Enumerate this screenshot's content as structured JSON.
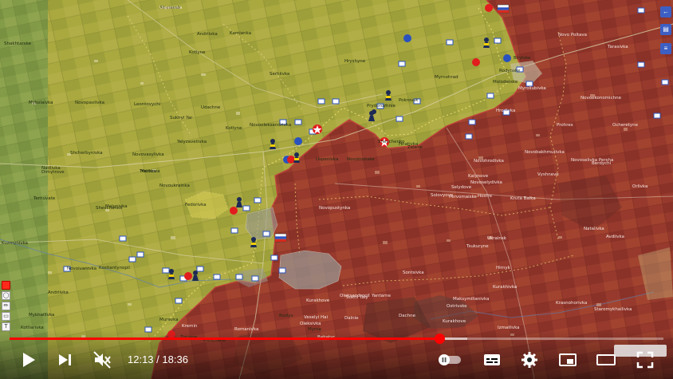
{
  "map": {
    "towns": [
      {
        "name": "Sloviansk",
        "tone": "lt"
      },
      {
        "name": "Andriivka",
        "tone": "lt"
      },
      {
        "name": "Kamianka",
        "tone": "lt"
      },
      {
        "name": "Shakhtarske",
        "tone": "lt"
      },
      {
        "name": "Kotlyne",
        "tone": "lt"
      },
      {
        "name": "Serhiivka",
        "tone": "lt"
      },
      {
        "name": "Hryshyne",
        "tone": "lt"
      },
      {
        "name": "Myrnohrad",
        "tone": "lt"
      },
      {
        "name": "Pokrovsk",
        "tone": "lt"
      },
      {
        "name": "Prydorozhnie",
        "tone": "lt"
      },
      {
        "name": "Bilytske",
        "tone": "lt"
      },
      {
        "name": "Rodynske",
        "tone": "lt"
      },
      {
        "name": "Molodetske",
        "tone": "lt"
      },
      {
        "name": "Mykolaivka",
        "tone": "lt"
      },
      {
        "name": "Novopavlivka",
        "tone": "lt"
      },
      {
        "name": "Novooleksandrivka",
        "tone": "lt"
      },
      {
        "name": "Udachne",
        "tone": "lt"
      },
      {
        "name": "Sukhyi Yar",
        "tone": "lt"
      },
      {
        "name": "Kotlyne",
        "tone": "lt"
      },
      {
        "name": "Shevchenko",
        "tone": "lt"
      },
      {
        "name": "Zelene",
        "tone": "lt"
      },
      {
        "name": "Uspenivka",
        "tone": "lt"
      },
      {
        "name": "Novotroitske",
        "tone": "lt"
      },
      {
        "name": "Hnativka",
        "tone": "lt"
      },
      {
        "name": "Hrodivka",
        "tone": "dk"
      },
      {
        "name": "Myroliubivka",
        "tone": "dk"
      },
      {
        "name": "Novoekonomichne",
        "tone": "dk"
      },
      {
        "name": "Novo Poltava",
        "tone": "dk"
      },
      {
        "name": "Tarasivka",
        "tone": "dk"
      },
      {
        "name": "Ocheretyne",
        "tone": "dk"
      },
      {
        "name": "Prohres",
        "tone": "dk"
      },
      {
        "name": "Novobakhmutivka",
        "tone": "dk"
      },
      {
        "name": "Berdychi",
        "tone": "dk"
      },
      {
        "name": "Novoselivka Persha",
        "tone": "dk"
      },
      {
        "name": "Orlivka",
        "tone": "dk"
      },
      {
        "name": "Novohrodivka",
        "tone": "dk"
      },
      {
        "name": "Kalynove",
        "tone": "dk"
      },
      {
        "name": "Solovyove",
        "tone": "dk"
      },
      {
        "name": "Pervomaiske",
        "tone": "dk"
      },
      {
        "name": "Hostre",
        "tone": "dk"
      },
      {
        "name": "Vyshneve",
        "tone": "dk"
      },
      {
        "name": "Selydove",
        "tone": "dk"
      },
      {
        "name": "Novoselydivka",
        "tone": "dk"
      },
      {
        "name": "Novopustynka",
        "tone": "dk"
      },
      {
        "name": "Kruta Balka",
        "tone": "dk"
      },
      {
        "name": "Sontsivka",
        "tone": "dk"
      },
      {
        "name": "Tsukuryne",
        "tone": "dk"
      },
      {
        "name": "Ukrainsk",
        "tone": "dk"
      },
      {
        "name": "Hirnyk",
        "tone": "dk"
      },
      {
        "name": "Natalivka",
        "tone": "dk"
      },
      {
        "name": "Avdiivka",
        "tone": "dk"
      },
      {
        "name": "Kurakhivka",
        "tone": "dk"
      },
      {
        "name": "Ostrivske",
        "tone": "dk"
      },
      {
        "name": "Izmailivka",
        "tone": "dk"
      },
      {
        "name": "Dachne",
        "tone": "dk"
      },
      {
        "name": "Kurakhove",
        "tone": "dk"
      },
      {
        "name": "Krasnohorivka",
        "tone": "dk"
      },
      {
        "name": "Staromykhailivka",
        "tone": "dk"
      },
      {
        "name": "Maksymilianivka",
        "tone": "dk"
      },
      {
        "name": "Oleksandropil",
        "tone": "dk"
      },
      {
        "name": "Oleksivka",
        "tone": "dk"
      },
      {
        "name": "Romanivka",
        "tone": "dk"
      },
      {
        "name": "Dalnie",
        "tone": "dk"
      },
      {
        "name": "Yantarne",
        "tone": "dk"
      },
      {
        "name": "Kremin",
        "tone": "dk"
      },
      {
        "name": "Veselyi Hai",
        "tone": "dk"
      },
      {
        "name": "Kurakhove",
        "tone": "dk"
      },
      {
        "name": "Troitske",
        "tone": "lt"
      },
      {
        "name": "Leontovychi",
        "tone": "lt"
      },
      {
        "name": "Yelyzavetivka",
        "tone": "lt"
      },
      {
        "name": "Novovasylivka",
        "tone": "lt"
      },
      {
        "name": "Shcherbynivka",
        "tone": "lt"
      },
      {
        "name": "Nadiivka",
        "tone": "lt"
      },
      {
        "name": "Dimytrove",
        "tone": "lt"
      },
      {
        "name": "Novoukrainka",
        "tone": "lt"
      },
      {
        "name": "Malynivka",
        "tone": "lt"
      },
      {
        "name": "Shevchenko",
        "tone": "lt"
      },
      {
        "name": "Ternuvate",
        "tone": "lt"
      },
      {
        "name": "Kuzmynivka",
        "tone": "lt"
      },
      {
        "name": "Mezhova",
        "tone": "lt"
      },
      {
        "name": "Fedorivka",
        "tone": "lt"
      },
      {
        "name": "Novoivanivka",
        "tone": "lt"
      },
      {
        "name": "Mykhailivka",
        "tone": "lt"
      },
      {
        "name": "Kostiantynopil",
        "tone": "lt"
      },
      {
        "name": "Andriivka",
        "tone": "lt"
      },
      {
        "name": "Kotliarivka",
        "tone": "lt"
      },
      {
        "name": "Muravka",
        "tone": "lt"
      },
      {
        "name": "Zoriane",
        "tone": "lt"
      },
      {
        "name": "Pishchane",
        "tone": "lt"
      },
      {
        "name": "Myrne",
        "tone": "lt"
      },
      {
        "name": "Rozlyv",
        "tone": "lt"
      },
      {
        "name": "Bahatyr",
        "tone": "dk"
      },
      {
        "name": "Sukhi Yaly",
        "tone": "dk"
      },
      {
        "name": "Uspenivka",
        "tone": "dk"
      }
    ],
    "colors": {
      "ukraine_held": "#a8a83c",
      "russia_held": "#96362b",
      "front_line": "#c0443a",
      "russian_flag_red": "#d52b1e",
      "unit_blue": "#2a52be"
    }
  },
  "sidebar_right": {
    "icons": [
      "arrow-left-icon",
      "layers-icon",
      "list-icon"
    ]
  },
  "drawing_toolbar": {
    "icons": [
      "color-swatch-icon",
      "marker-icon",
      "pen-icon",
      "eraser-icon",
      "text-icon"
    ]
  },
  "player": {
    "current_time": "12:13",
    "separator": " / ",
    "duration": "18:36",
    "progress": 0.6568,
    "buffered": 0.7,
    "muted": true,
    "autoplay_on": false,
    "controls": [
      "play-icon",
      "next-icon",
      "mute-icon",
      "autoplay-toggle",
      "subtitles-icon",
      "settings-icon",
      "miniplayer-icon",
      "theater-icon",
      "fullscreen-icon"
    ],
    "accent": "#ff0000"
  }
}
